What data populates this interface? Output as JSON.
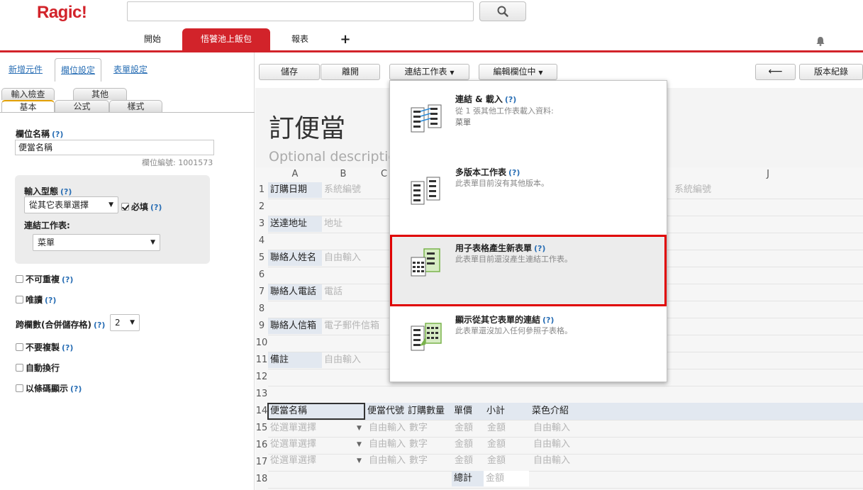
{
  "header": {
    "logo": "Ragic!",
    "search_value": "",
    "nav_tabs": [
      {
        "label": "開始",
        "active": false
      },
      {
        "label": "悟饕池上飯包",
        "active": true
      },
      {
        "label": "報表",
        "active": false
      },
      {
        "label": "+",
        "active": false
      }
    ],
    "icons": {
      "search": "search-icon",
      "bell": "bell-icon"
    }
  },
  "left_panel": {
    "tabs": [
      {
        "label": "新增元件",
        "active": false
      },
      {
        "label": "欄位設定",
        "active": true
      },
      {
        "label": "表單設定",
        "active": false
      }
    ],
    "subtabs_row1": [
      "輸入檢查",
      "其他"
    ],
    "subtabs_row2": [
      {
        "label": "基本",
        "active": true
      },
      {
        "label": "公式",
        "active": false
      },
      {
        "label": "樣式",
        "active": false
      }
    ],
    "field_name_label": "欄位名稱",
    "help": "(?)",
    "field_name_value": "便當名稱",
    "field_id": "欄位編號: 1001573",
    "input_type_label": "輸入型態",
    "input_type_value": "從其它表單選擇",
    "required_label": "必填",
    "required_checked": true,
    "link_sheet_label": "連結工作表:",
    "link_sheet_value": "菜單",
    "options": [
      {
        "label": "不可重複",
        "help": true,
        "checked": false
      },
      {
        "label": "唯讀",
        "help": true,
        "checked": false
      },
      {
        "label": "不要複製",
        "help": true,
        "checked": false
      },
      {
        "label": "自動換行",
        "help": false,
        "checked": false
      },
      {
        "label": "以條碼顯示",
        "help": true,
        "checked": false
      }
    ],
    "colspan_label": "跨欄數(合併儲存格)",
    "colspan_value": "2"
  },
  "toolbar": {
    "save": "儲存",
    "leave": "離開",
    "link_sheet": "連結工作表",
    "editing_field": "編輯欄位中",
    "back_arrow": "⟵",
    "version_history": "版本紀錄"
  },
  "form": {
    "title": "訂便當",
    "description_placeholder": "Optional descriptio",
    "columns": [
      "A",
      "B",
      "C",
      "J"
    ],
    "rows": [
      "1",
      "2",
      "3",
      "4",
      "5",
      "6",
      "7",
      "8",
      "9",
      "10",
      "11",
      "12",
      "13",
      "14",
      "15",
      "16",
      "17",
      "18"
    ],
    "fields": [
      {
        "label": "訂購日期",
        "placeholder": "系統編號"
      },
      {
        "label": "送達地址",
        "placeholder": "地址"
      },
      {
        "label": "聯絡人姓名",
        "placeholder": "自由輸入"
      },
      {
        "label": "聯絡人電話",
        "placeholder": "電話"
      },
      {
        "label": "聯絡人信箱",
        "placeholder": "電子郵件信箱"
      },
      {
        "label": "備註",
        "placeholder": "自由輸入"
      }
    ],
    "row1_right_placeholder": "系統編號",
    "subtable_headers": [
      "便當名稱",
      "便當代號",
      "訂購數量",
      "單價",
      "小計",
      "菜色介紹"
    ],
    "subtable_rows": [
      [
        "從選單選擇",
        "自由輸入",
        "數字",
        "金額",
        "金額",
        "自由輸入"
      ],
      [
        "從選單選擇",
        "自由輸入",
        "數字",
        "金額",
        "金額",
        "自由輸入"
      ],
      [
        "從選單選擇",
        "自由輸入",
        "數字",
        "金額",
        "金額",
        "自由輸入"
      ]
    ],
    "total_label": "總計",
    "total_placeholder": "金額"
  },
  "dropdown": {
    "items": [
      {
        "title": "連結 & 載入",
        "help": "(?)",
        "desc1": "從 1 張其他工作表載入資料:",
        "desc1_bold": "1",
        "desc2": "菜單"
      },
      {
        "title": "多版本工作表",
        "help": "(?)",
        "desc1": "此表單目前沒有其他版本。"
      },
      {
        "title": "用子表格產生新表單",
        "help": "(?)",
        "desc1": "此表單目前還沒產生連結工作表。"
      },
      {
        "title": "顯示從其它表單的連結",
        "help": "(?)",
        "desc1": "此表單還沒加入任何參照子表格。"
      }
    ]
  },
  "colors": {
    "brand": "#d2232a",
    "highlight": "#e00000",
    "link": "#2a6fb5"
  }
}
